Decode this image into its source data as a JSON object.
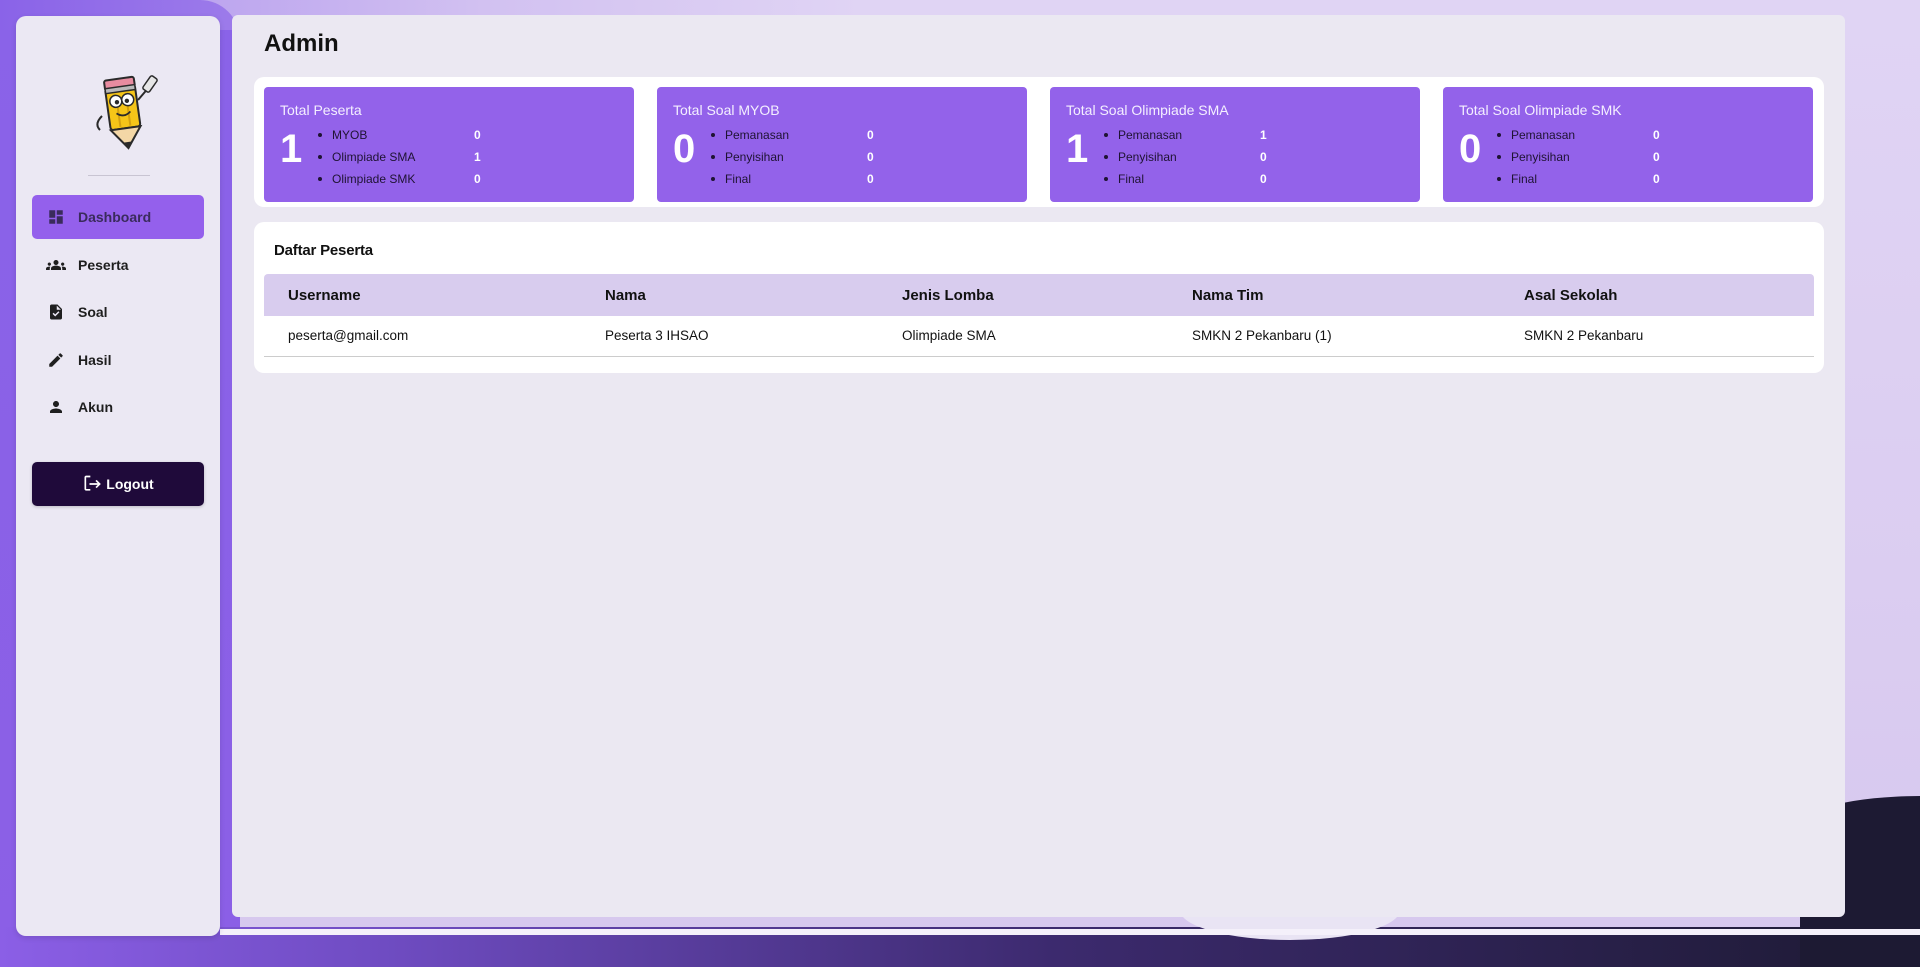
{
  "sidebar": {
    "items": [
      {
        "label": "Dashboard",
        "icon": "dashboard-icon",
        "active": true
      },
      {
        "label": "Peserta",
        "icon": "group-icon",
        "active": false
      },
      {
        "label": "Soal",
        "icon": "document-check-icon",
        "active": false
      },
      {
        "label": "Hasil",
        "icon": "pencil-icon",
        "active": false
      },
      {
        "label": "Akun",
        "icon": "person-icon",
        "active": false
      }
    ],
    "logout_label": "Logout"
  },
  "page": {
    "title": "Admin"
  },
  "stats": [
    {
      "title": "Total Peserta",
      "total": "1",
      "rows": [
        {
          "label": "MYOB",
          "value": "0"
        },
        {
          "label": "Olimpiade SMA",
          "value": "1"
        },
        {
          "label": "Olimpiade SMK",
          "value": "0"
        }
      ]
    },
    {
      "title": "Total Soal MYOB",
      "total": "0",
      "rows": [
        {
          "label": "Pemanasan",
          "value": "0"
        },
        {
          "label": "Penyisihan",
          "value": "0"
        },
        {
          "label": "Final",
          "value": "0"
        }
      ]
    },
    {
      "title": "Total Soal Olimpiade SMA",
      "total": "1",
      "rows": [
        {
          "label": "Pemanasan",
          "value": "1"
        },
        {
          "label": "Penyisihan",
          "value": "0"
        },
        {
          "label": "Final",
          "value": "0"
        }
      ]
    },
    {
      "title": "Total Soal Olimpiade SMK",
      "total": "0",
      "rows": [
        {
          "label": "Pemanasan",
          "value": "0"
        },
        {
          "label": "Penyisihan",
          "value": "0"
        },
        {
          "label": "Final",
          "value": "0"
        }
      ]
    }
  ],
  "table": {
    "title": "Daftar Peserta",
    "columns": [
      "Username",
      "Nama",
      "Jenis Lomba",
      "Nama Tim",
      "Asal Sekolah"
    ],
    "rows": [
      [
        "peserta@gmail.com",
        "Peserta 3 IHSAO",
        "Olimpiade SMA",
        "SMKN 2 Pekanbaru (1)",
        "SMKN 2 Pekanbaru"
      ]
    ]
  },
  "colors": {
    "accent": "#9362ea",
    "logout_bg": "#1f0a3a",
    "table_header_bg": "#d8ccee"
  }
}
